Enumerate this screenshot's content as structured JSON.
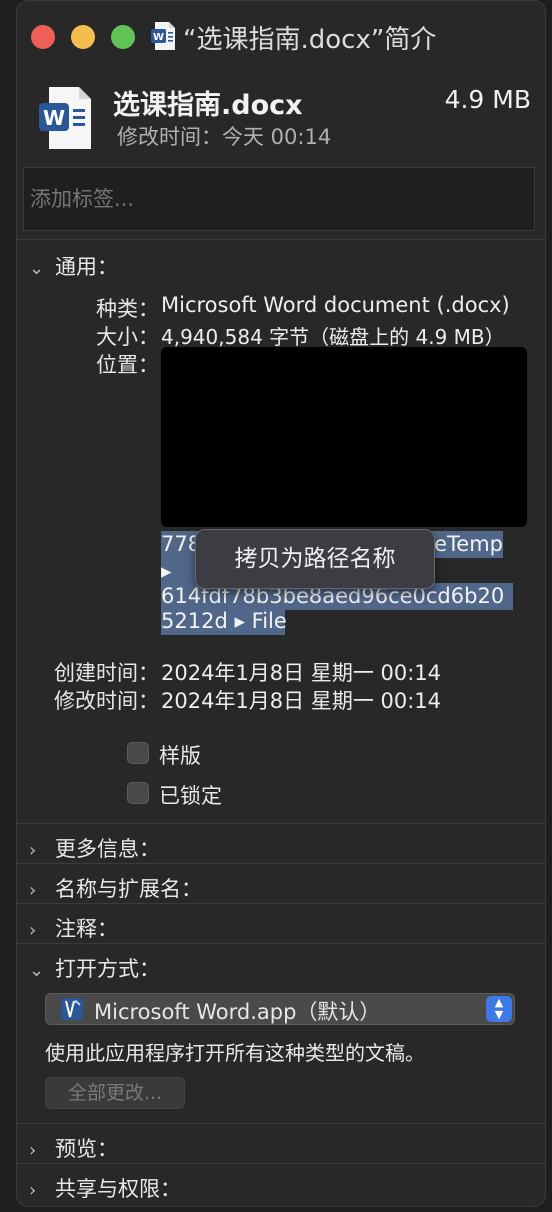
{
  "window": {
    "title": "“选课指南.docx”简介"
  },
  "header": {
    "file_name": "选课指南.docx",
    "file_size": "4.9 MB",
    "modified": "修改时间：今天 00:14"
  },
  "tags": {
    "placeholder": "添加标签..."
  },
  "general": {
    "title": "通用：",
    "kind_label": "种类：",
    "kind_value": "Microsoft Word document (.docx)",
    "size_label": "大小：",
    "size_value": "4,940,584 字节（磁盘上的 4.9 MB）",
    "location_label": "位置：",
    "path_line1_start": "778",
    "path_line1_end": "eTemp",
    "path_line2": "▸",
    "path_line3": "614fdf78b3be8aed96ce0cd6b20",
    "path_line4": "5212d ▸ File",
    "created_label": "创建时间：",
    "created_value": "2024年1月8日 星期一 00:14",
    "modified_label": "修改时间：",
    "modified_value": "2024年1月8日 星期一 00:14",
    "stationery_label": "样版",
    "locked_label": "已锁定"
  },
  "context_menu": {
    "copy_path": "拷贝为路径名称"
  },
  "sections": {
    "more_info": "更多信息：",
    "name_ext": "名称与扩展名：",
    "comments": "注释：",
    "open_with": "打开方式：",
    "preview": "预览：",
    "sharing": "共享与权限："
  },
  "open_with": {
    "app": "Microsoft Word.app（默认）",
    "description": "使用此应用程序打开所有这种类型的文稿。",
    "change_all": "全部更改..."
  },
  "icons": {
    "close": "close-traffic-light",
    "minimize": "minimize-traffic-light",
    "maximize": "zoom-traffic-light",
    "word": "word-document-icon",
    "word_app": "word-app-icon",
    "chevron_down": "chevron-down-icon",
    "chevron_right": "chevron-right-icon",
    "select_arrows": "up-down-arrows-icon"
  },
  "colors": {
    "close": "#ee5f57",
    "minimize": "#f4bd4f",
    "maximize": "#5fc454",
    "accent": "#3d7ae6",
    "selection": "#51678a",
    "word_blue": "#2b5797"
  }
}
